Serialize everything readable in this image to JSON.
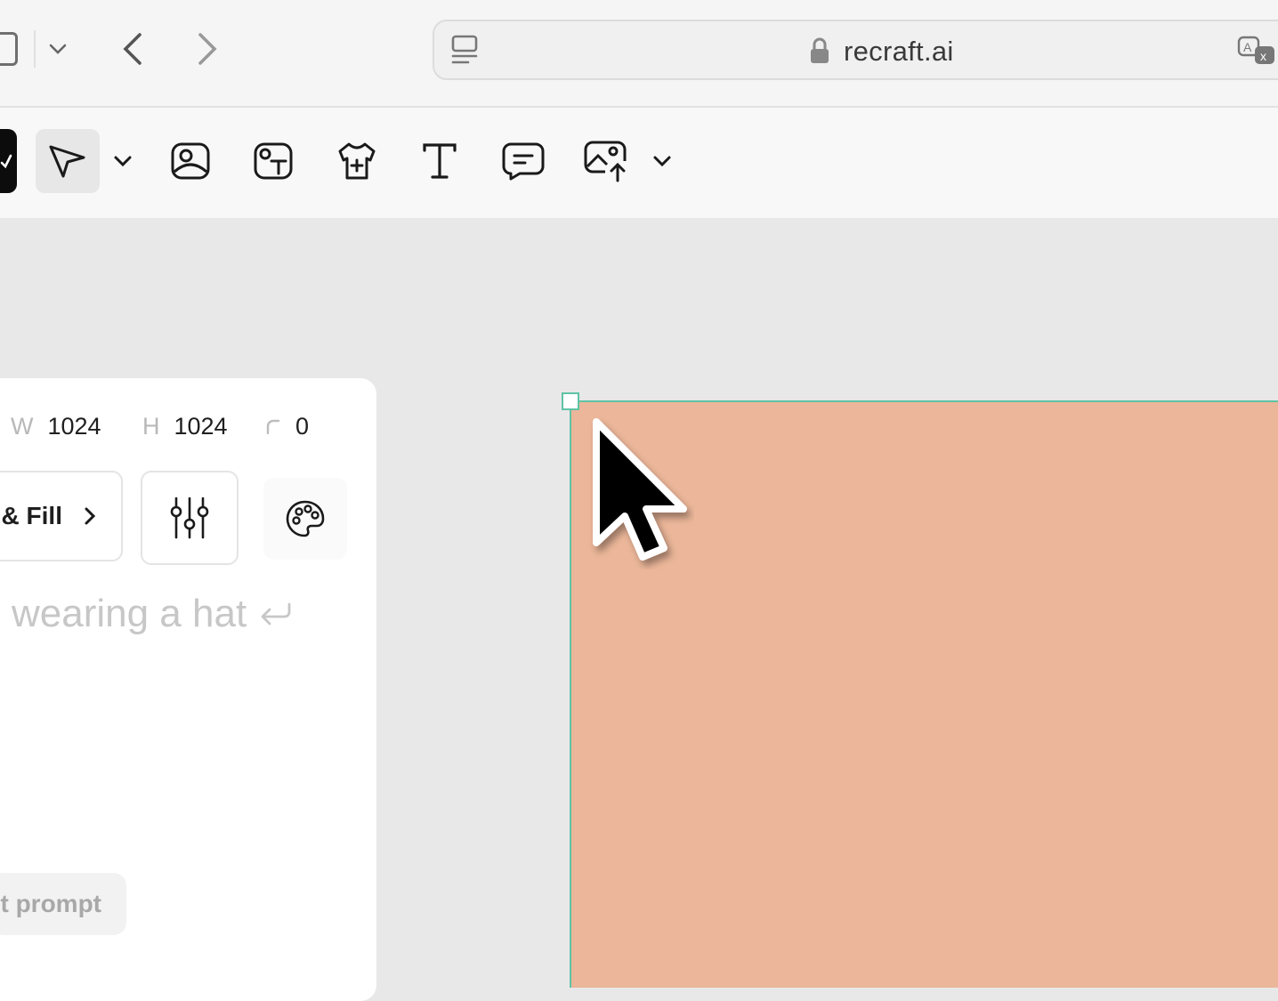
{
  "browser": {
    "url": "recraft.ai",
    "icons": [
      "tab-overview-icon",
      "chevron-down-icon",
      "back-arrow-icon",
      "forward-arrow-icon",
      "reader-icon",
      "lock-icon",
      "translate-icon"
    ]
  },
  "toolbar": {
    "tools": [
      "select-tool",
      "image-tool",
      "image-text-tool",
      "mockup-tool",
      "text-tool",
      "comment-tool",
      "upload-tool"
    ]
  },
  "panel": {
    "width_label": "W",
    "width_value": "1024",
    "height_label": "H",
    "height_value": "1024",
    "radius_value": "0",
    "fill_button_label": "& Fill",
    "prompt_placeholder": "wearing a hat",
    "prompt_button_label": "t prompt"
  },
  "canvas": {
    "frame_color": "#ebb699",
    "selection_color": "#5fc3a6"
  }
}
